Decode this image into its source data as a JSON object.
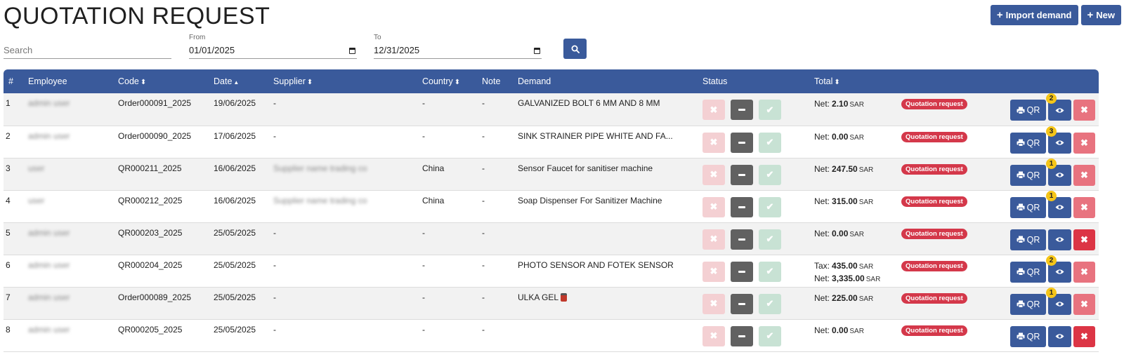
{
  "page": {
    "title": "QUOTATION REQUEST"
  },
  "top_actions": {
    "import_label": "Import demand",
    "new_label": "New"
  },
  "filters": {
    "search_placeholder": "Search",
    "from_label": "From",
    "from_value": "01/01/2025",
    "to_label": "To",
    "to_value": "12/31/2025"
  },
  "table": {
    "headers": {
      "num": "#",
      "employee": "Employee",
      "code": "Code",
      "date": "Date",
      "supplier": "Supplier",
      "country": "Country",
      "note": "Note",
      "demand": "Demand",
      "status": "Status",
      "total": "Total"
    },
    "rows": [
      {
        "num": "1",
        "employee": "admin user",
        "code": "Order000091_2025",
        "date": "19/06/2025",
        "supplier": "-",
        "supplier_blurred": false,
        "country": "-",
        "note": "-",
        "demand": "GALVANIZED BOLT 6 MM AND 8 MM",
        "totals": [
          {
            "label": "Net:",
            "amount": "2.10",
            "currency": "SAR"
          }
        ],
        "badge": "Quotation request",
        "view_count": "2",
        "delete_strong": false
      },
      {
        "num": "2",
        "employee": "admin user",
        "code": "Order000090_2025",
        "date": "17/06/2025",
        "supplier": "-",
        "supplier_blurred": false,
        "country": "-",
        "note": "-",
        "demand": "SINK STRAINER PIPE WHITE AND FA...",
        "totals": [
          {
            "label": "Net:",
            "amount": "0.00",
            "currency": "SAR"
          }
        ],
        "badge": "Quotation request",
        "view_count": "3",
        "delete_strong": false
      },
      {
        "num": "3",
        "employee": "user",
        "code": "QR000211_2025",
        "date": "16/06/2025",
        "supplier": "Supplier name trading co",
        "supplier_blurred": true,
        "country": "China",
        "note": "-",
        "demand": "Sensor Faucet for sanitiser machine",
        "totals": [
          {
            "label": "Net:",
            "amount": "247.50",
            "currency": "SAR"
          }
        ],
        "badge": "Quotation request",
        "view_count": "1",
        "delete_strong": false
      },
      {
        "num": "4",
        "employee": "user",
        "code": "QR000212_2025",
        "date": "16/06/2025",
        "supplier": "Supplier name trading co",
        "supplier_blurred": true,
        "country": "China",
        "note": "-",
        "demand": "Soap Dispenser For Sanitizer Machine",
        "totals": [
          {
            "label": "Net:",
            "amount": "315.00",
            "currency": "SAR"
          }
        ],
        "badge": "Quotation request",
        "view_count": "1",
        "delete_strong": false
      },
      {
        "num": "5",
        "employee": "admin user",
        "code": "QR000203_2025",
        "date": "25/05/2025",
        "supplier": "-",
        "supplier_blurred": false,
        "country": "-",
        "note": "-",
        "demand": "",
        "totals": [
          {
            "label": "Net:",
            "amount": "0.00",
            "currency": "SAR"
          }
        ],
        "badge": "Quotation request",
        "view_count": "",
        "delete_strong": true
      },
      {
        "num": "6",
        "employee": "admin user",
        "code": "QR000204_2025",
        "date": "25/05/2025",
        "supplier": "-",
        "supplier_blurred": false,
        "country": "-",
        "note": "-",
        "demand": "PHOTO SENSOR AND FOTEK SENSOR",
        "totals": [
          {
            "label": "Tax:",
            "amount": "435.00",
            "currency": "SAR"
          },
          {
            "label": "Net:",
            "amount": "3,335.00",
            "currency": "SAR"
          }
        ],
        "badge": "Quotation request",
        "view_count": "2",
        "delete_strong": false
      },
      {
        "num": "7",
        "employee": "admin user",
        "code": "Order000089_2025",
        "date": "25/05/2025",
        "supplier": "-",
        "supplier_blurred": false,
        "country": "-",
        "note": "-",
        "demand": "ULKA GEL",
        "demand_icon": "jar-icon",
        "totals": [
          {
            "label": "Net:",
            "amount": "225.00",
            "currency": "SAR"
          }
        ],
        "badge": "Quotation request",
        "view_count": "1",
        "delete_strong": false
      },
      {
        "num": "8",
        "employee": "admin user",
        "code": "QR000205_2025",
        "date": "25/05/2025",
        "supplier": "-",
        "supplier_blurred": false,
        "country": "-",
        "note": "-",
        "demand": "",
        "totals": [
          {
            "label": "Net:",
            "amount": "0.00",
            "currency": "SAR"
          }
        ],
        "badge": "Quotation request",
        "view_count": "",
        "delete_strong": true
      }
    ],
    "qr_label": "QR"
  },
  "colors": {
    "primary": "#3a5a9b",
    "badge_red": "#d4384a",
    "reject_light": "#f4d0d3",
    "approve_light": "#c8e2d4",
    "pending_dark": "#616161",
    "count_yellow": "#f5c518"
  }
}
